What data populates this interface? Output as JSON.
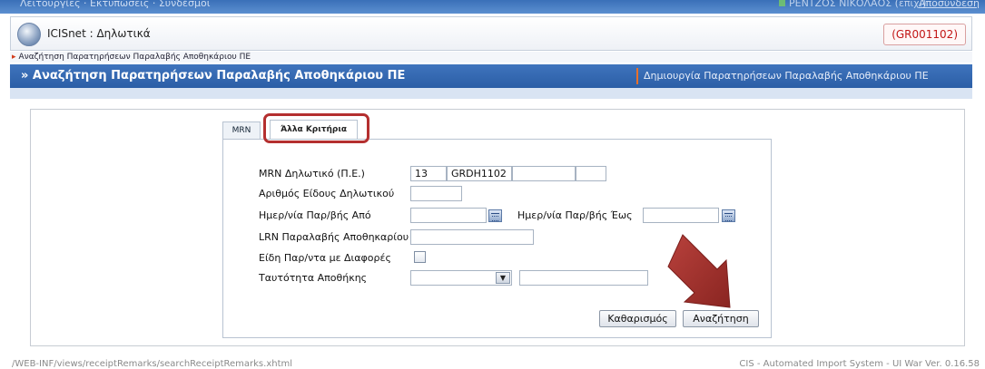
{
  "topbar": {
    "menu": "Λειτουργίες · Εκτυπώσεις · Συνδέσμοι",
    "user": "ΡΕΝΤΖΟΣ ΝΙΚΟΛΑΟΣ (επιχ.)",
    "logout": "Αποσύνδεση"
  },
  "app": {
    "title": "ICISnet : Δηλωτικά",
    "code": "(GR001102)"
  },
  "breadcrumb": {
    "item": "Αναζήτηση Παρατηρήσεων Παραλαβής Αποθηκάριου ΠΕ"
  },
  "titlebar": {
    "title": "» Αναζήτηση Παρατηρήσεων Παραλαβής Αποθηκάριου ΠΕ",
    "create_link": "Δημιουργία Παρατηρήσεων Παραλαβής Αποθηκάριου ΠΕ"
  },
  "tabs": [
    {
      "label": "MRN",
      "active": false
    },
    {
      "label": "Άλλα Κριτήρια",
      "active": true
    }
  ],
  "form": {
    "mrn_label": "MRN Δηλωτικό (Π.Ε.)",
    "mrn_year": "13",
    "mrn_office": "GRDH1102",
    "mrn_seq": "",
    "mrn_check": "",
    "item_no_label": "Αριθμός Είδους Δηλωτικού",
    "item_no_value": "",
    "date_from_label": "Ημερ/νία Παρ/βής Από",
    "date_from_value": "",
    "date_to_label": "Ημερ/νία Παρ/βής Έως",
    "date_to_value": "",
    "lrn_label": "LRN Παραλαβής Αποθηκαρίου",
    "lrn_value": "",
    "diff_label": "Είδη Παρ/ντα με Διαφορές",
    "diff_checked": false,
    "warehouse_label": "Ταυτότητα Αποθήκης",
    "warehouse_select": "",
    "warehouse_value": ""
  },
  "buttons": {
    "clear": "Καθαρισμός",
    "search": "Αναζήτηση"
  },
  "footer": {
    "path": "/WEB-INF/views/receiptRemarks/searchReceiptRemarks.xhtml",
    "version": "CIS - Automated Import System - UI War Ver. 0.16.58"
  },
  "colors": {
    "titlebar": "#2b5ea6",
    "highlight": "#b42f2f",
    "code": "#c21717"
  }
}
